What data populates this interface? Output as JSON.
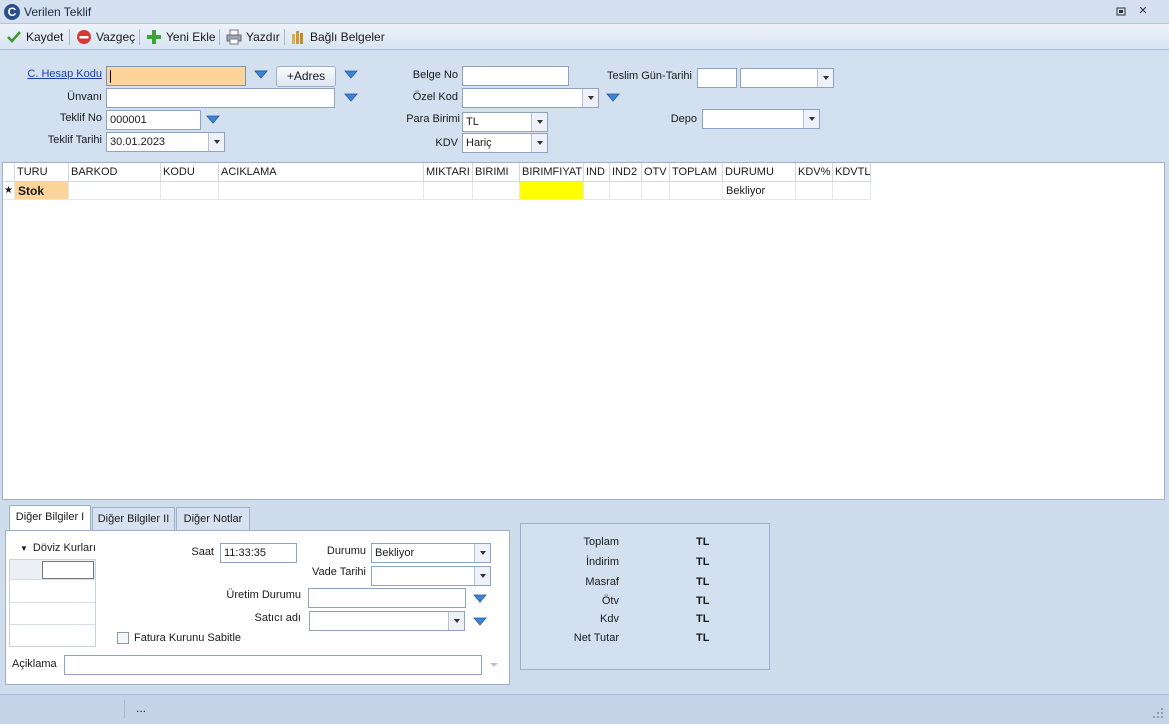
{
  "window": {
    "title": "Verilen Teklif",
    "logo_letter": "C"
  },
  "toolbar": {
    "save": "Kaydet",
    "cancel": "Vazgeç",
    "new": "Yeni Ekle",
    "print": "Yazdır",
    "attachments": "Bağlı Belgeler"
  },
  "form": {
    "account_code_label": "C. Hesap Kodu",
    "account_code_value": "",
    "add_address_label": "+Adres",
    "title_label": "Ünvanı",
    "title_value": "",
    "offer_no_label": "Teklif No",
    "offer_no_value": "000001",
    "offer_date_label": "Teklif Tarihi",
    "offer_date_value": "30.01.2023",
    "doc_no_label": "Belge No",
    "doc_no_value": "",
    "special_code_label": "Özel Kod",
    "special_code_value": "",
    "currency_label": "Para Birimi",
    "currency_value": "TL",
    "vat_label": "KDV",
    "vat_value": "Hariç",
    "delivery_label": "Teslim Gün-Tarihi",
    "delivery_days": "",
    "delivery_date": "",
    "depot_label": "Depo",
    "depot_value": ""
  },
  "grid": {
    "columns": [
      "TURU",
      "BARKOD",
      "KODU",
      "ACIKLAMA",
      "MIKTARI",
      "BIRIMI",
      "BIRIMFIYAT",
      "IND",
      "IND2",
      "OTV",
      "TOPLAM",
      "DURUMU",
      "KDV%",
      "KDVTL"
    ],
    "new_row_marker": "★",
    "rows": [
      {
        "turu": "Stok",
        "durumu": "Bekliyor"
      }
    ]
  },
  "tabs": [
    "Diğer Bilgiler I",
    "Diğer Bilgiler II",
    "Diğer Notlar"
  ],
  "details": {
    "currency_rates_label": "Döviz Kurları",
    "time_label": "Saat",
    "time_value": "11:33:35",
    "status_label": "Durumu",
    "status_value": "Bekliyor",
    "due_date_label": "Vade Tarihi",
    "due_date_value": "",
    "production_status_label": "Üretim Durumu",
    "production_status_value": "",
    "seller_label": "Satıcı adı",
    "seller_value": "",
    "fixed_rate_label": "Fatura Kurunu Sabitle",
    "note_label": "Açiklama",
    "note_value": ""
  },
  "totals": {
    "rows": [
      {
        "label": "Toplam",
        "value": "TL"
      },
      {
        "label": "İndirim",
        "value": "TL"
      },
      {
        "label": "Masraf",
        "value": "TL"
      },
      {
        "label": "Ötv",
        "value": "TL"
      },
      {
        "label": "Kdv",
        "value": "TL"
      },
      {
        "label": "Net Tutar",
        "value": "TL"
      }
    ]
  },
  "status_bar": {
    "text": "..."
  },
  "colors": {
    "highlight_field": "#fdd49a",
    "price_cell": "#ffff00",
    "link": "#1c3fae"
  }
}
